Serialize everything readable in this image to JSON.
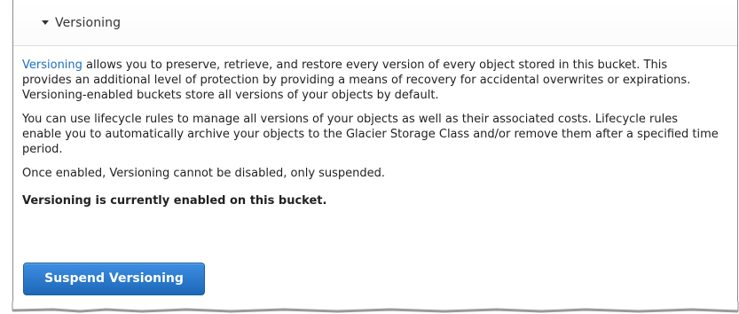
{
  "section": {
    "title": "Versioning",
    "toggle_icon": "caret-down-icon",
    "expanded": true
  },
  "description": {
    "link_text": "Versioning",
    "paragraph1_rest": " allows you to preserve, retrieve, and restore every version of every object stored in this bucket. This provides an additional level of protection by providing a means of recovery for accidental overwrites or expirations. Versioning-enabled buckets store all versions of your objects by default.",
    "paragraph2": "You can use lifecycle rules to manage all versions of your objects as well as their associated costs. Lifecycle rules enable you to automatically archive your objects to the Glacier Storage Class and/or remove them after a specified time period.",
    "paragraph3": "Once enabled, Versioning cannot be disabled, only suspended."
  },
  "status": {
    "text": "Versioning is currently enabled on this bucket."
  },
  "actions": {
    "suspend_label": "Suspend Versioning"
  },
  "colors": {
    "link": "#1a6fc0",
    "button_top": "#3d8ee2",
    "button_bottom": "#1c67b8",
    "border": "#8c8c8c"
  }
}
